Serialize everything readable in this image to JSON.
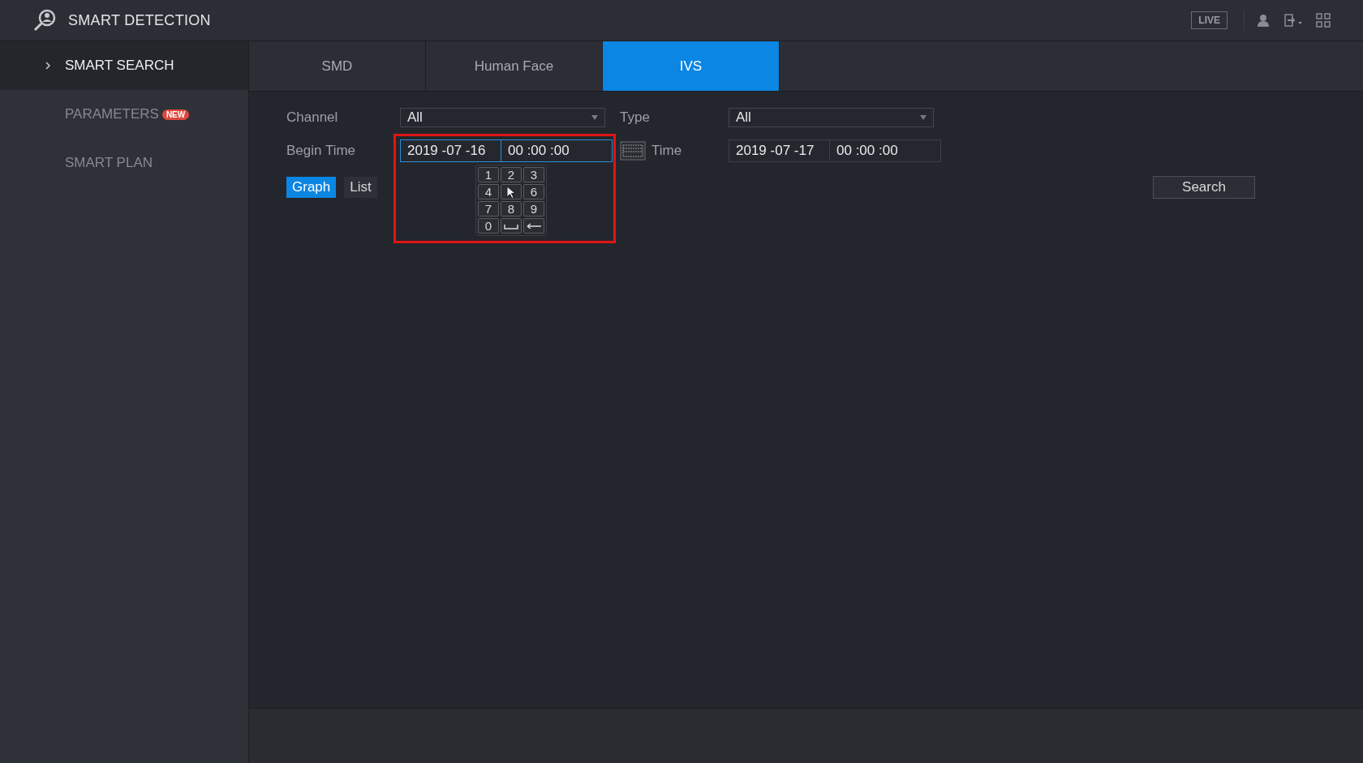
{
  "header": {
    "title": "SMART DETECTION",
    "live_button": "LIVE"
  },
  "sidebar": {
    "items": [
      {
        "label": "SMART SEARCH",
        "selected": true
      },
      {
        "label": "PARAMETERS",
        "selected": false,
        "badge": "NEW"
      },
      {
        "label": "SMART PLAN",
        "selected": false
      }
    ]
  },
  "tabs": [
    {
      "label": "SMD",
      "selected": false
    },
    {
      "label": "Human Face",
      "selected": false
    },
    {
      "label": "IVS",
      "selected": true
    }
  ],
  "form": {
    "channel": {
      "label": "Channel",
      "value": "All"
    },
    "type": {
      "label": "Type",
      "value": "All"
    },
    "begin_time": {
      "label": "Begin Time",
      "date": "2019 -07 -16",
      "time": "00 :00 :00",
      "focused": true
    },
    "end_time": {
      "label": "Time",
      "date": "2019 -07 -17",
      "time": "00 :00 :00",
      "focused": false
    }
  },
  "view_modes": [
    {
      "label": "Graph",
      "selected": true
    },
    {
      "label": "List",
      "selected": false
    }
  ],
  "search_button": "Search",
  "keypad": {
    "keys": [
      {
        "kind": "digit",
        "label": "1"
      },
      {
        "kind": "digit",
        "label": "2"
      },
      {
        "kind": "digit",
        "label": "3"
      },
      {
        "kind": "digit",
        "label": "4"
      },
      {
        "kind": "covered"
      },
      {
        "kind": "digit",
        "label": "6"
      },
      {
        "kind": "digit",
        "label": "7"
      },
      {
        "kind": "digit",
        "label": "8"
      },
      {
        "kind": "digit",
        "label": "9"
      },
      {
        "kind": "digit",
        "label": "0"
      },
      {
        "kind": "space"
      },
      {
        "kind": "backspace"
      }
    ]
  }
}
